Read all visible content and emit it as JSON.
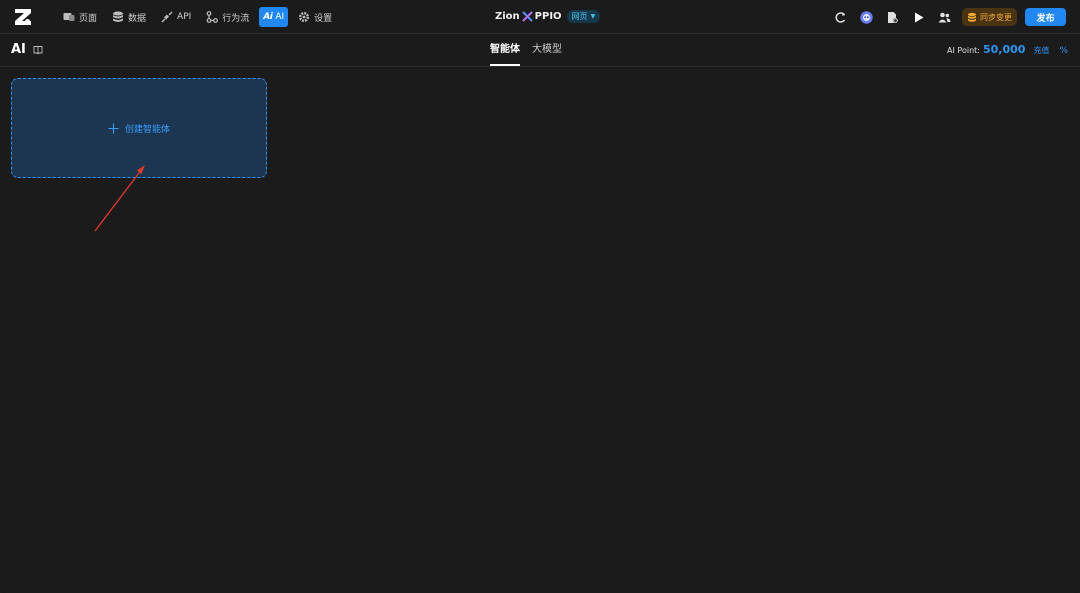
{
  "topbar": {
    "nav": [
      {
        "label": "页面",
        "icon": "page-icon"
      },
      {
        "label": "数据",
        "icon": "database-icon"
      },
      {
        "label": "API",
        "icon": "api-icon"
      },
      {
        "label": "行为流",
        "icon": "flow-icon"
      },
      {
        "label": "AI",
        "badge": "Ai",
        "icon": "ai-icon",
        "active": true
      },
      {
        "label": "设置",
        "icon": "gear-icon"
      }
    ],
    "project": {
      "name_left": "Zion",
      "name_right": "PPIO",
      "page_badge": "网页"
    },
    "sync_label": "同步变更",
    "publish_label": "发布"
  },
  "subbar": {
    "title": "AI",
    "tabs": [
      {
        "label": "智能体",
        "active": true
      },
      {
        "label": "大模型",
        "active": false
      }
    ],
    "points_label": "AI Point:",
    "points_value": "50,000",
    "recharge_label": "充值",
    "percent_label": "%"
  },
  "content": {
    "create_label": "创建智能体"
  },
  "colors": {
    "accent": "#2088f0",
    "background": "#1b1b1b",
    "card_bg": "#1c3550",
    "sync_text": "#f4a93a",
    "badge_text": "#4cc2e8"
  }
}
